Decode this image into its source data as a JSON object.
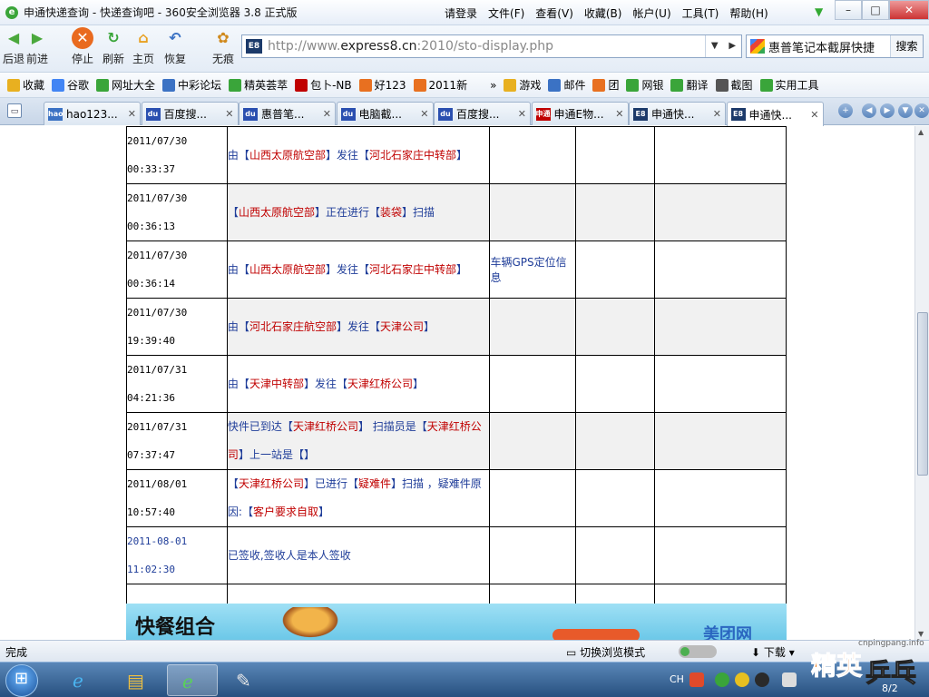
{
  "window": {
    "title": "申通快递查询 - 快递查询吧 - 360安全浏览器 3.8 正式版",
    "menu": [
      "请登录",
      "文件(F)",
      "查看(V)",
      "收藏(B)",
      "帐户(U)",
      "工具(T)",
      "帮助(H)"
    ],
    "controls": {
      "min": "–",
      "max": "□",
      "close": "✕"
    }
  },
  "toolbar": {
    "back_label": "后退",
    "forward_label": "前进",
    "stop_label": "停止",
    "refresh_label": "刷新",
    "home_label": "主页",
    "restore_label": "恢复",
    "notrace_label": "无痕",
    "address_prefix": "http://www.",
    "address_host": "express8.cn",
    "address_path": ":2010/sto-display.php",
    "search_text": "惠普笔记本截屏快捷",
    "search_button": "搜索"
  },
  "favorites": [
    {
      "label": "收藏",
      "color": "#e8b020"
    },
    {
      "label": "谷歌",
      "color": "#4285f4"
    },
    {
      "label": "网址大全",
      "color": "#3aa53a"
    },
    {
      "label": "中彩论坛",
      "color": "#3b72c4"
    },
    {
      "label": "精英荟萃",
      "color": "#3aa53a"
    },
    {
      "label": "包卜-NB",
      "color": "#c00000"
    },
    {
      "label": "好123",
      "color": "#e87020"
    },
    {
      "label": "2011新",
      "color": "#e87020"
    },
    {
      "label": "»",
      "color": "transparent"
    },
    {
      "label": "游戏",
      "color": "#e8b020"
    },
    {
      "label": "邮件",
      "color": "#3b72c4"
    },
    {
      "label": "团",
      "color": "#e87020"
    },
    {
      "label": "网银",
      "color": "#3aa53a"
    },
    {
      "label": "翻译",
      "color": "#3aa53a"
    },
    {
      "label": "截图",
      "color": "#555555"
    },
    {
      "label": "实用工具",
      "color": "#3aa53a"
    }
  ],
  "tabs": [
    {
      "label": "hao123...",
      "icon_color": "#3b72c4",
      "icon_text": "hao"
    },
    {
      "label": "百度搜...",
      "icon_color": "#2a4fb0",
      "icon_text": "du"
    },
    {
      "label": "惠普笔...",
      "icon_color": "#2a4fb0",
      "icon_text": "du"
    },
    {
      "label": "电脑截...",
      "icon_color": "#2a4fb0",
      "icon_text": "du"
    },
    {
      "label": "百度搜...",
      "icon_color": "#2a4fb0",
      "icon_text": "du"
    },
    {
      "label": "申通E物...",
      "icon_color": "#c00000",
      "icon_text": "申通"
    },
    {
      "label": "申通快...",
      "icon_color": "#1c3a6a",
      "icon_text": "E8"
    },
    {
      "label": "申通快...",
      "icon_color": "#1c3a6a",
      "icon_text": "E8",
      "active": true
    }
  ],
  "tracking": [
    {
      "date": "2011/07/30",
      "time": "00:33:37",
      "parts": [
        [
          "",
          "由【"
        ],
        [
          "r",
          "山西太原航空部"
        ],
        [
          "",
          "】发往【"
        ],
        [
          "r",
          "河北石家庄中转部"
        ],
        [
          "",
          "】"
        ]
      ],
      "extra": "",
      "alt": false
    },
    {
      "date": "2011/07/30",
      "time": "00:36:13",
      "parts": [
        [
          "",
          "【"
        ],
        [
          "r",
          "山西太原航空部"
        ],
        [
          "",
          "】正在进行【"
        ],
        [
          "r",
          "装袋"
        ],
        [
          "",
          "】扫描"
        ]
      ],
      "extra": "",
      "alt": true
    },
    {
      "date": "2011/07/30",
      "time": "00:36:14",
      "parts": [
        [
          "",
          "由【"
        ],
        [
          "r",
          "山西太原航空部"
        ],
        [
          "",
          "】发往【"
        ],
        [
          "r",
          "河北石家庄中转部"
        ],
        [
          "",
          "】"
        ]
      ],
      "extra": "车辆GPS定位信息",
      "alt": false
    },
    {
      "date": "2011/07/30",
      "time": "19:39:40",
      "parts": [
        [
          "",
          "由【"
        ],
        [
          "r",
          "河北石家庄航空部"
        ],
        [
          "",
          "】发往【"
        ],
        [
          "r",
          "天津公司"
        ],
        [
          "",
          "】"
        ]
      ],
      "extra": "",
      "alt": true
    },
    {
      "date": "2011/07/31",
      "time": "04:21:36",
      "parts": [
        [
          "",
          "由【"
        ],
        [
          "r",
          "天津中转部"
        ],
        [
          "",
          "】发往【"
        ],
        [
          "r",
          "天津红桥公司"
        ],
        [
          "",
          "】"
        ]
      ],
      "extra": "",
      "alt": false
    },
    {
      "date": "2011/07/31",
      "time": "07:37:47",
      "parts": [
        [
          "",
          "快件已到达【"
        ],
        [
          "r",
          "天津红桥公司"
        ],
        [
          "",
          "】 扫描员是【"
        ],
        [
          "r",
          "天津红桥公"
        ],
        [
          "br",
          ""
        ],
        [
          "r",
          "司"
        ],
        [
          "",
          "】上一站是【】"
        ]
      ],
      "extra": "",
      "alt": true
    },
    {
      "date": "2011/08/01",
      "time": "10:57:40",
      "parts": [
        [
          "",
          "【"
        ],
        [
          "r",
          "天津红桥公司"
        ],
        [
          "",
          "】已进行【"
        ],
        [
          "r",
          "疑难件"
        ],
        [
          "",
          "】扫描 ，疑难件原"
        ],
        [
          "br",
          ""
        ],
        [
          "",
          "因:【"
        ],
        [
          "r",
          "客户要求自取"
        ],
        [
          "",
          "】"
        ]
      ],
      "extra": "",
      "alt": false
    },
    {
      "date": "2011-08-01",
      "time": "11:02:30",
      "parts": [
        [
          "",
          "已签收,签收人是本人签收"
        ]
      ],
      "extra": "",
      "alt": false,
      "last": true
    }
  ],
  "banner": {
    "left_text": "快餐组合",
    "right_text": "美团网"
  },
  "status": {
    "done": "完成",
    "mode": "切换浏览模式",
    "download": "下载",
    "watermark_url": "cnpingpang.info",
    "watermark_text1": "精英",
    "watermark_text2": "乒乓网"
  },
  "taskbar": {
    "ime": "CH",
    "page": "8/2"
  }
}
